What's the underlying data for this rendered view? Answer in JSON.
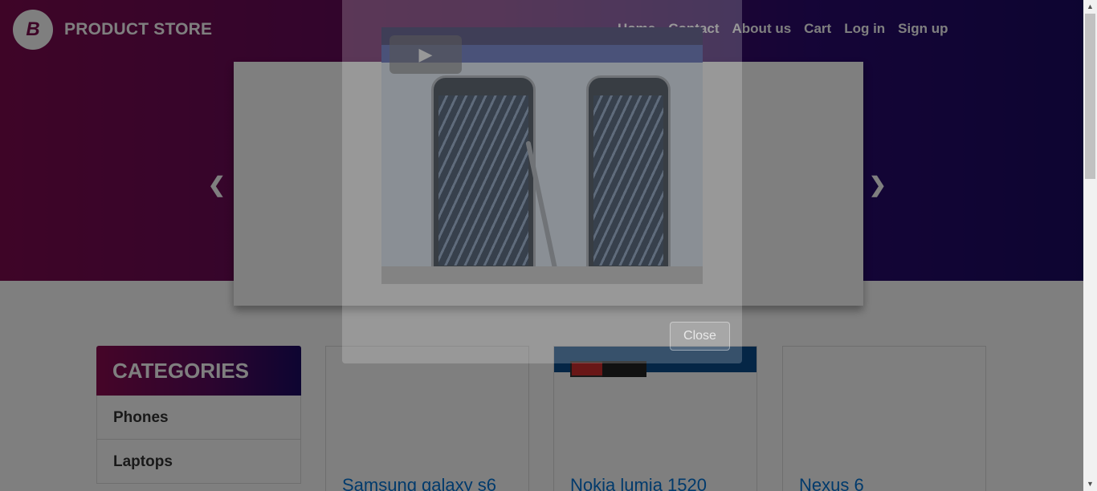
{
  "header": {
    "brand": "PRODUCT STORE",
    "logo_letter": "B",
    "nav": [
      "Home",
      "Contact",
      "About us",
      "Cart",
      "Log in",
      "Sign up"
    ]
  },
  "carousel": {
    "prev_icon": "chevron-left-icon",
    "next_icon": "chevron-right-icon",
    "play_icon": "play-icon"
  },
  "categories": {
    "title": "CATEGORIES",
    "items": [
      "Phones",
      "Laptops"
    ]
  },
  "products": [
    {
      "title": "Samsung galaxy s6"
    },
    {
      "title": "Nokia lumia 1520"
    },
    {
      "title": "Nexus 6"
    }
  ],
  "modal": {
    "close_label": "Close"
  },
  "colors": {
    "brand_primary": "#7d0b4f",
    "brand_secondary": "#1b0a63",
    "link": "#0275d8"
  }
}
